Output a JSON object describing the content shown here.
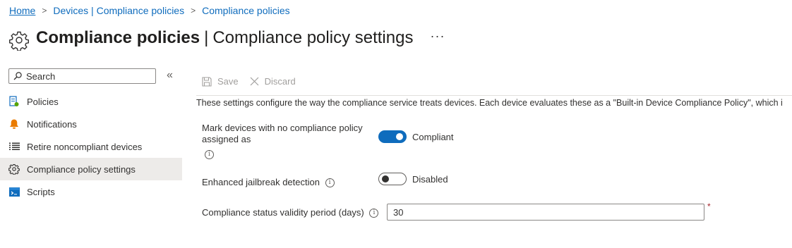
{
  "breadcrumb": {
    "items": [
      "Home",
      "Devices | Compliance policies",
      "Compliance policies"
    ],
    "separator": ">"
  },
  "header": {
    "title_strong": "Compliance policies",
    "title_separator": "|",
    "title_light": "Compliance policy settings",
    "more": "···",
    "icon": "gear-icon"
  },
  "sidebar": {
    "search_placeholder": "Search",
    "collapse_glyph": "«",
    "items": [
      {
        "label": "Policies",
        "icon": "policies-icon"
      },
      {
        "label": "Notifications",
        "icon": "bell-icon"
      },
      {
        "label": "Retire noncompliant devices",
        "icon": "list-icon"
      },
      {
        "label": "Compliance policy settings",
        "icon": "gear-icon",
        "selected": true
      },
      {
        "label": "Scripts",
        "icon": "script-icon"
      }
    ]
  },
  "toolbar": {
    "save_label": "Save",
    "discard_label": "Discard"
  },
  "main": {
    "description": "These settings configure the way the compliance service treats devices. Each device evaluates these as a \"Built-in Device Compliance Policy\", which i",
    "settings": {
      "no_policy": {
        "label_line1": "Mark devices with no compliance policy",
        "label_line2": "assigned as",
        "value": "Compliant",
        "on": true
      },
      "jailbreak": {
        "label": "Enhanced jailbreak detection",
        "value": "Disabled",
        "on": false
      },
      "validity": {
        "label": "Compliance status validity period (days)",
        "value": "30",
        "required_mark": "*"
      }
    },
    "info_glyph": "i"
  },
  "colors": {
    "accent": "#0f6cbd",
    "selected_bg": "#edebe9",
    "required": "#a4262c"
  }
}
